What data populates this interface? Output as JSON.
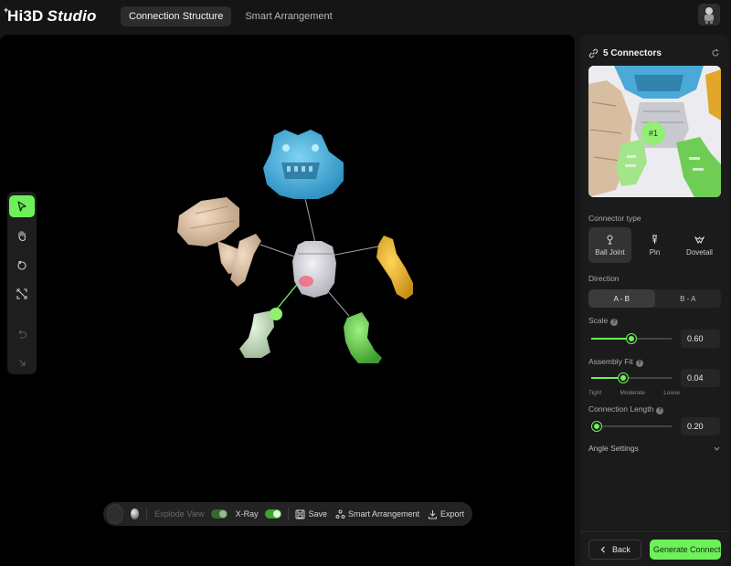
{
  "app": {
    "name_main": "Hi3D",
    "name_italic": "Studio"
  },
  "tabs": [
    {
      "label": "Connection Structure",
      "active": true
    },
    {
      "label": "Smart Arrangement",
      "active": false
    }
  ],
  "tools": [
    "select-arrow-icon",
    "hand-pan-icon",
    "rotate-icon",
    "fit-expand-icon",
    "undo-icon",
    "redo-icon"
  ],
  "bottombar": {
    "explode_label": "Explode View",
    "xray_label": "X-Ray",
    "save_label": "Save",
    "smart_label": "Smart Arrangement",
    "export_label": "Export"
  },
  "panel": {
    "title": "5 Connectors",
    "preview_badge": "#1",
    "connector_type_label": "Connector type",
    "connector_types": [
      {
        "label": "Ball Joint",
        "icon": "ball-joint-icon",
        "active": true
      },
      {
        "label": "Pin",
        "icon": "pin-icon",
        "active": false
      },
      {
        "label": "Dovetail",
        "icon": "dovetail-icon",
        "active": false
      }
    ],
    "direction_label": "Direction",
    "directions": [
      {
        "label": "A - B",
        "active": true
      },
      {
        "label": "B - A",
        "active": false
      }
    ],
    "scale_label": "Scale",
    "scale_value": "0.60",
    "scale_fraction": 0.5,
    "fit_label": "Assembly Fit",
    "fit_value": "0.04",
    "fit_fraction": 0.4,
    "fit_scale_labels": [
      "Tight",
      "Moderate",
      "Loose"
    ],
    "length_label": "Connection Length",
    "length_value": "0.20",
    "length_fraction": 0.07,
    "angle_label": "Angle Settings",
    "back_label": "Back",
    "generate_label": "Generate Connectors"
  },
  "colors": {
    "accent": "#6ef05a",
    "background": "#151515",
    "viewport": "#000000",
    "panel": "#1b1b1b"
  }
}
